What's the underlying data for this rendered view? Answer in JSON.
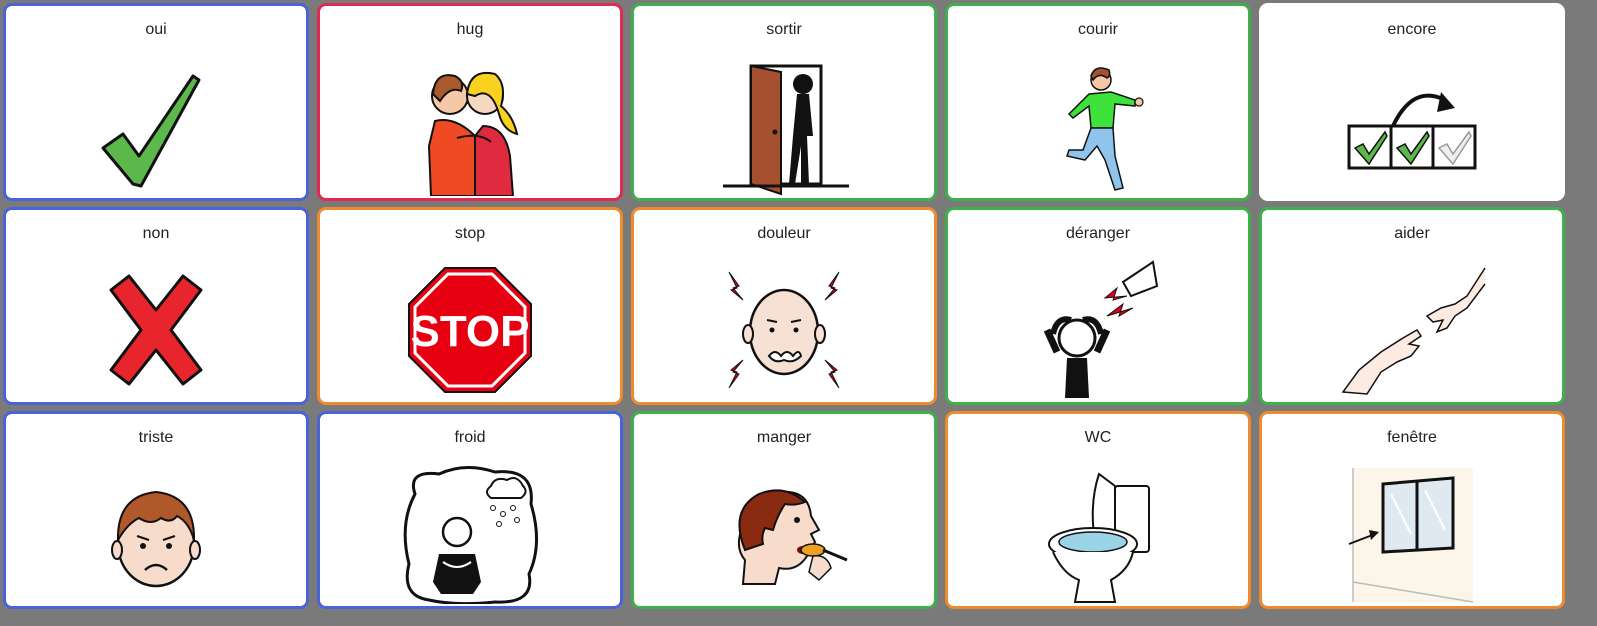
{
  "board": {
    "tiles": [
      {
        "label": "oui",
        "border": "blue",
        "icon": "checkmark-icon"
      },
      {
        "label": "hug",
        "border": "red",
        "icon": "hug-icon"
      },
      {
        "label": "sortir",
        "border": "green",
        "icon": "exit-door-icon"
      },
      {
        "label": "courir",
        "border": "green",
        "icon": "running-boy-icon"
      },
      {
        "label": "encore",
        "border": "none",
        "icon": "repeat-checks-icon"
      },
      {
        "label": "non",
        "border": "blue",
        "icon": "cross-icon"
      },
      {
        "label": "stop",
        "border": "orange",
        "icon": "stop-sign-icon"
      },
      {
        "label": "douleur",
        "border": "orange",
        "icon": "headache-icon"
      },
      {
        "label": "déranger",
        "border": "green",
        "icon": "disturbed-noise-icon"
      },
      {
        "label": "aider",
        "border": "green",
        "icon": "helping-hands-icon"
      },
      {
        "label": "triste",
        "border": "blue",
        "icon": "sad-face-icon"
      },
      {
        "label": "froid",
        "border": "blue",
        "icon": "cold-icon"
      },
      {
        "label": "manger",
        "border": "green",
        "icon": "eating-icon"
      },
      {
        "label": "WC",
        "border": "orange",
        "icon": "toilet-icon"
      },
      {
        "label": "fenêtre",
        "border": "orange",
        "icon": "window-icon"
      }
    ]
  },
  "colors": {
    "blue": "#4a63d8",
    "red": "#e02a52",
    "green": "#3fb14a",
    "orange": "#f08a2e",
    "background": "#7a7a7a"
  }
}
